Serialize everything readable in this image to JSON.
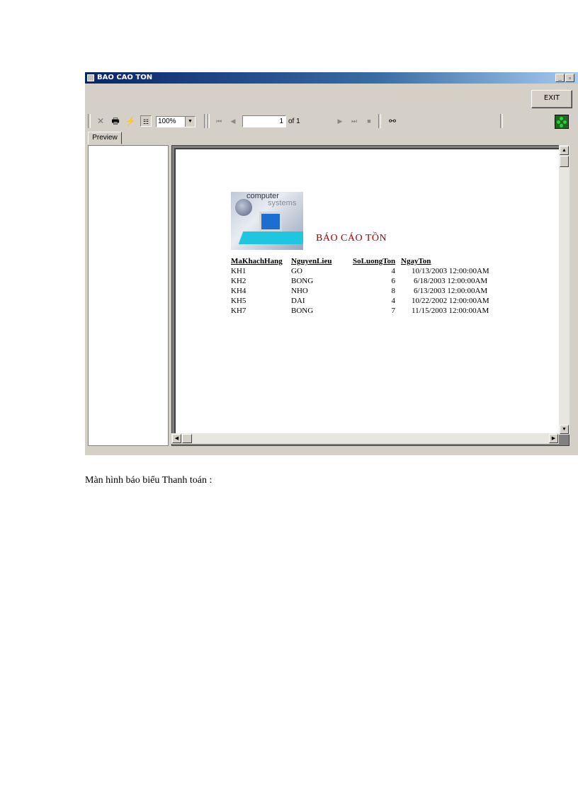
{
  "window": {
    "title": "BAO CAO TON"
  },
  "exit_label": "EXIT",
  "toolbar": {
    "zoom": "100%",
    "page": "1",
    "page_of": "of 1"
  },
  "tab_label": "Preview",
  "report": {
    "logo_text_1": "computer",
    "logo_text_2": "systems",
    "title": "BÁO CÁO TỒN",
    "columns": [
      "MaKhachHang",
      "NguyenLieu",
      "SoLuongTon",
      "NgayTon"
    ],
    "rows": [
      [
        "KH1",
        "GO",
        "4",
        "10/13/2003  12:00:00AM"
      ],
      [
        "KH2",
        "BONG",
        "6",
        "6/18/2003  12:00:00AM"
      ],
      [
        "KH4",
        "NHO",
        "8",
        "6/13/2003  12:00:00AM"
      ],
      [
        "KH5",
        "DAI",
        "4",
        "10/22/2002  12:00:00AM"
      ],
      [
        "KH7",
        "BONG",
        "7",
        "11/15/2003  12:00:00AM"
      ]
    ]
  },
  "caption": "Màn hình báo biểu Thanh toán :",
  "icons": {
    "close": "close-icon",
    "print": "printer-icon",
    "refresh": "lightning-icon",
    "tree": "group-tree-icon",
    "find": "binoculars-icon"
  }
}
